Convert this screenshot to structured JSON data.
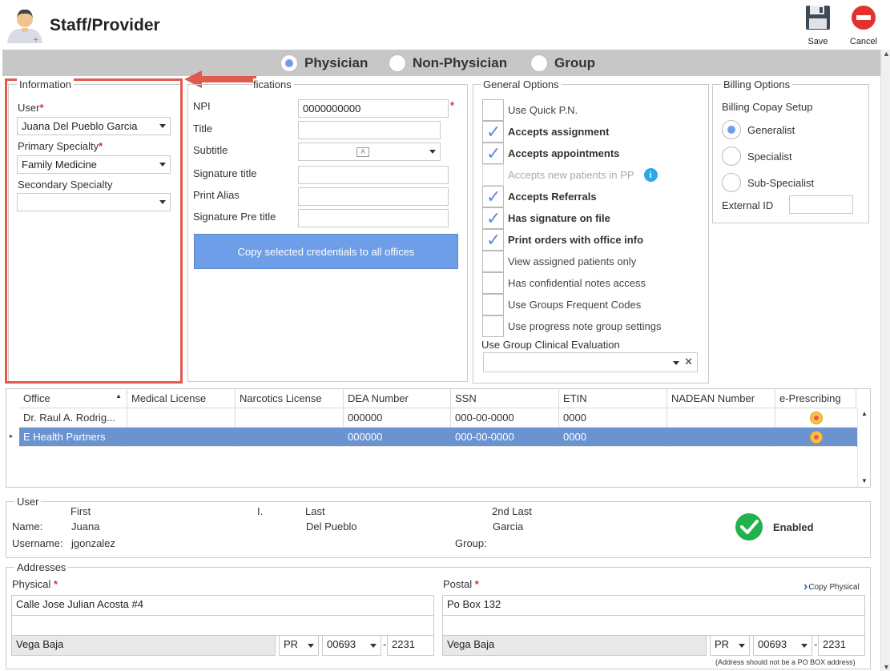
{
  "app": {
    "title": "Staff/Provider",
    "save_label": "Save",
    "cancel_label": "Cancel"
  },
  "provider_type": {
    "options": [
      "Physician",
      "Non-Physician",
      "Group"
    ],
    "selected": "Physician"
  },
  "information": {
    "legend": "Information",
    "user_label": "User",
    "user_value": "Juana Del Pueblo Garcia",
    "primary_specialty_label": "Primary Specialty",
    "primary_specialty_value": "Family Medicine",
    "secondary_specialty_label": "Secondary Specialty",
    "secondary_specialty_value": ""
  },
  "identifications": {
    "legend": "Identifications",
    "npi_label": "NPI",
    "npi_value": "0000000000",
    "title_label": "Title",
    "title_value": "",
    "subtitle_label": "Subtitle",
    "signature_title_label": "Signature title",
    "signature_title_value": "",
    "print_alias_label": "Print Alias",
    "print_alias_value": "",
    "signature_pre_title_label": "Signature Pre title",
    "signature_pre_title_value": "",
    "copy_button": "Copy selected credentials to all offices"
  },
  "general_options": {
    "legend": "General Options",
    "items": [
      {
        "label": "Use Quick P.N.",
        "checked": false,
        "disabled": false
      },
      {
        "label": "Accepts assignment",
        "checked": true,
        "disabled": false
      },
      {
        "label": "Accepts appointments",
        "checked": true,
        "disabled": false
      },
      {
        "label": "Accepts new patients in PP",
        "checked": false,
        "disabled": true
      },
      {
        "label": "Accepts Referrals",
        "checked": true,
        "disabled": false
      },
      {
        "label": "Has signature on file",
        "checked": true,
        "disabled": false
      },
      {
        "label": "Print orders with office info",
        "checked": true,
        "disabled": false
      },
      {
        "label": "View assigned patients only",
        "checked": false,
        "disabled": false
      },
      {
        "label": "Has confidential notes access",
        "checked": false,
        "disabled": false
      },
      {
        "label": "Use Groups Frequent Codes",
        "checked": false,
        "disabled": false
      },
      {
        "label": "Use progress note group settings",
        "checked": false,
        "disabled": false
      }
    ],
    "clinical_eval_label": "Use Group Clinical Evaluation",
    "clinical_eval_value": ""
  },
  "billing_options": {
    "legend": "Billing Options",
    "copay_label": "Billing Copay Setup",
    "options": [
      "Generalist",
      "Specialist",
      "Sub-Specialist"
    ],
    "selected": "Generalist",
    "external_id_label": "External ID",
    "external_id_value": ""
  },
  "offices_table": {
    "columns": [
      "Office",
      "Medical License",
      "Narcotics License",
      "DEA Number",
      "SSN",
      "ETIN",
      "NADEAN Number",
      "e-Prescribing"
    ],
    "rows": [
      [
        "Dr. Raul A. Rodrig...",
        "",
        "",
        "000000",
        "000-00-0000",
        "0000",
        ""
      ],
      [
        "E Health Partners",
        "",
        "",
        "000000",
        "000-00-0000",
        "0000",
        ""
      ]
    ]
  },
  "user_section": {
    "legend": "User",
    "first_label": "First",
    "i_label": "I.",
    "last_label": "Last",
    "second_last_label": "2nd Last",
    "name_label": "Name:",
    "first": "Juana",
    "last": "Del Pueblo",
    "second_last": "Garcia",
    "username_label": "Username:",
    "username": "jgonzalez",
    "group_label": "Group:",
    "group": "",
    "status": "Enabled"
  },
  "addresses": {
    "legend": "Addresses",
    "physical_label": "Physical",
    "postal_label": "Postal",
    "copy_physical": "Copy Physical",
    "physical": {
      "line1": "Calle Jose Julian Acosta #4",
      "line2": "",
      "city": "Vega Baja",
      "state": "PR",
      "zip": "00693",
      "zip4": "2231"
    },
    "postal": {
      "line1": "Po Box 132",
      "line2": "",
      "city": "Vega Baja",
      "state": "PR",
      "zip": "00693",
      "zip4": "2231"
    },
    "note": "(Address should not be a PO BOX address)"
  },
  "colors": {
    "accent": "#6f9ee8",
    "highlight_row": "#6b93cf",
    "callout": "#e05a4e",
    "enabled_green": "#22b14c"
  }
}
